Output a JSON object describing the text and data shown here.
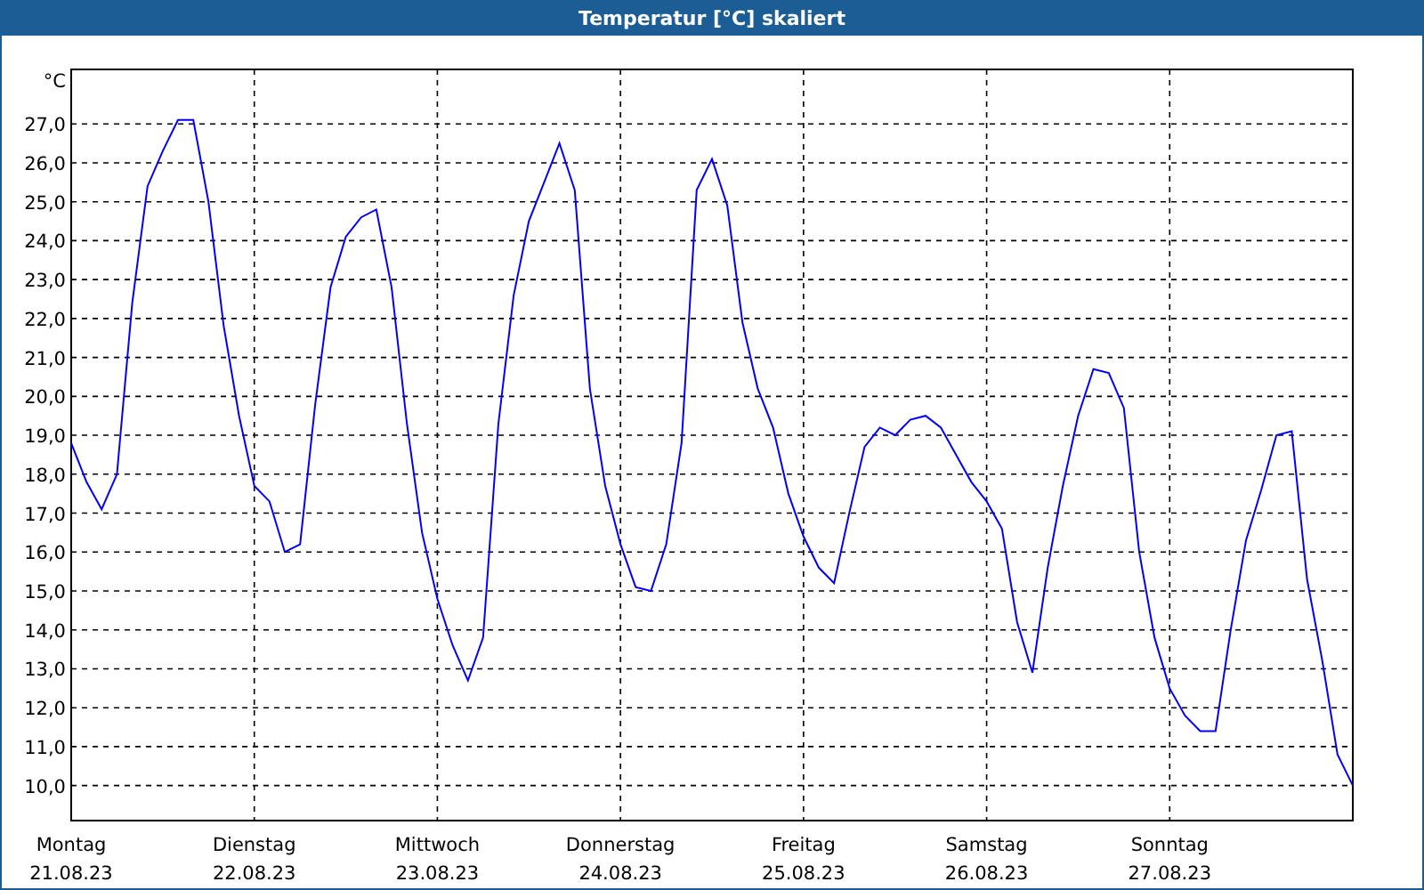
{
  "window": {
    "title": "Temperatur [°C] skaliert"
  },
  "chart": {
    "dates": [
      "21.08.23",
      "22.08.23",
      "23.08.23",
      "24.08.23",
      "25.08.23",
      "26.08.23",
      "27.08.23"
    ],
    "chart_data": {
      "type": "line",
      "grid": true,
      "ylabel": "°C",
      "ylim": [
        9.1,
        28.4
      ],
      "yticks": [
        {
          "value": 10,
          "label": "10,0"
        },
        {
          "value": 11,
          "label": "11,0"
        },
        {
          "value": 12,
          "label": "12,0"
        },
        {
          "value": 13,
          "label": "13,0"
        },
        {
          "value": 14,
          "label": "14,0"
        },
        {
          "value": 15,
          "label": "15,0"
        },
        {
          "value": 16,
          "label": "16,0"
        },
        {
          "value": 17,
          "label": "17,0"
        },
        {
          "value": 18,
          "label": "18,0"
        },
        {
          "value": 19,
          "label": "19,0"
        },
        {
          "value": 20,
          "label": "20,0"
        },
        {
          "value": 21,
          "label": "21,0"
        },
        {
          "value": 22,
          "label": "22,0"
        },
        {
          "value": 23,
          "label": "23,0"
        },
        {
          "value": 24,
          "label": "24,0"
        },
        {
          "value": 25,
          "label": "25,0"
        },
        {
          "value": 26,
          "label": "26,0"
        },
        {
          "value": 27,
          "label": "27,0"
        }
      ],
      "categories": [
        "Montag",
        null,
        null,
        null,
        null,
        null,
        null,
        null,
        null,
        null,
        null,
        null,
        "Dienstag",
        null,
        null,
        null,
        null,
        null,
        null,
        null,
        null,
        null,
        null,
        null,
        "Mittwoch",
        null,
        null,
        null,
        null,
        null,
        null,
        null,
        null,
        null,
        null,
        null,
        "Donnerstag",
        null,
        null,
        null,
        null,
        null,
        null,
        null,
        null,
        null,
        null,
        null,
        "Freitag",
        null,
        null,
        null,
        null,
        null,
        null,
        null,
        null,
        null,
        null,
        null,
        "Samstag",
        null,
        null,
        null,
        null,
        null,
        null,
        null,
        null,
        null,
        null,
        null,
        "Sonntag",
        null,
        null,
        null,
        null,
        null,
        null,
        null,
        null,
        null,
        null,
        null,
        null
      ],
      "series": [
        {
          "color": "#0000ff",
          "values": [
            18.8,
            17.8,
            17.1,
            18.0,
            22.4,
            25.4,
            26.3,
            27.1,
            27.1,
            25.0,
            21.8,
            19.5,
            17.7,
            17.3,
            16.0,
            16.2,
            19.8,
            22.8,
            24.1,
            24.6,
            24.8,
            22.8,
            19.3,
            16.5,
            14.8,
            13.6,
            12.7,
            13.8,
            19.3,
            22.6,
            24.5,
            25.5,
            26.5,
            25.3,
            20.2,
            17.7,
            16.2,
            15.1,
            15.0,
            16.2,
            18.8,
            25.3,
            26.1,
            24.9,
            21.9,
            20.2,
            19.2,
            17.5,
            16.4,
            15.6,
            15.2,
            17.0,
            18.7,
            19.2,
            19.0,
            19.4,
            19.5,
            19.2,
            18.5,
            17.8,
            17.3,
            16.6,
            14.2,
            12.9,
            15.6,
            17.7,
            19.5,
            20.7,
            20.6,
            19.7,
            16.0,
            13.8,
            12.5,
            11.8,
            11.4,
            11.4,
            14.0,
            16.3,
            17.6,
            19.0,
            19.1,
            15.3,
            13.2,
            10.8,
            10.0
          ]
        }
      ]
    }
  }
}
